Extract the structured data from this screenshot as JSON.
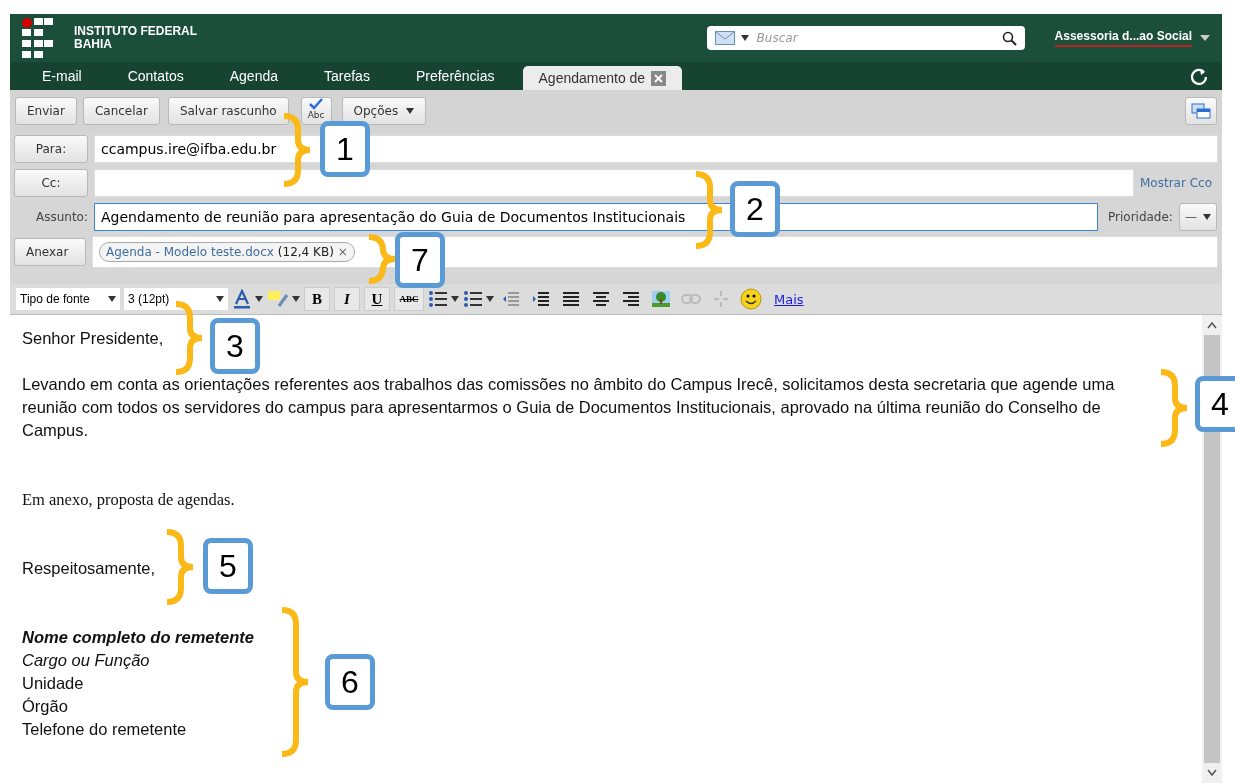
{
  "header": {
    "logo_lines": [
      "INSTITUTO FEDERAL",
      "BAHIA"
    ],
    "search": {
      "placeholder": "Buscar"
    },
    "user": "Assessoria d...ao Social"
  },
  "nav_tabs": [
    {
      "label": "E-mail",
      "selected": false
    },
    {
      "label": "Contatos",
      "selected": false
    },
    {
      "label": "Agenda",
      "selected": false
    },
    {
      "label": "Tarefas",
      "selected": false
    },
    {
      "label": "Preferências",
      "selected": false
    },
    {
      "label": "Agendamento de",
      "selected": true,
      "closable": true
    }
  ],
  "toolbar": {
    "buttons": [
      {
        "label": "Enviar",
        "kind": "plain"
      },
      {
        "label": "Cancelar",
        "kind": "plain"
      },
      {
        "label": "Salvar rascunho",
        "kind": "plain"
      },
      {
        "label": "Abc",
        "kind": "spell"
      },
      {
        "label": "Opções",
        "kind": "menu"
      }
    ]
  },
  "fields": {
    "to": {
      "label": "Para:",
      "value": "ccampus.ire@ifba.edu.br"
    },
    "cc": {
      "label": "Cc:",
      "link": "Mostrar Cco"
    },
    "subject": {
      "label": "Assunto:",
      "value": "Agendamento de reunião para apresentação do Guia de Documentos Institucionais",
      "focused": true
    },
    "priority": {
      "label": "Prioridade:",
      "value": "—"
    },
    "attach": {
      "label": "Anexar",
      "file": "Agenda - Modelo teste.docx",
      "size": "(12,4 KB)",
      "remove": "×"
    }
  },
  "editor_toolbar": {
    "font": "Tipo de fonte",
    "size": "3 (12pt)",
    "format": [
      "B",
      "I",
      "U",
      "ABC"
    ],
    "more": "Mais"
  },
  "body": [
    {
      "text": "Senhor Presidente,",
      "kind": "line"
    },
    {
      "text": "Levando em conta as orientações referentes aos trabalhos das comissões no âmbito do Campus Irecê, solicitamos desta secretaria que agende uma reunião com todos os servidores do campus para apresentarmos o Guia de Documentos Institucionais, aprovado na última reunião do Conselho de Campus.",
      "kind": "line"
    },
    {
      "text": "Em anexo, proposta de agendas.",
      "kind": "serif"
    },
    {
      "text": "Respeitosamente,",
      "kind": "line"
    },
    {
      "lines": [
        {
          "text": "Nome completo do remetente",
          "kind": "bolditalic"
        },
        {
          "text": "Cargo ou Função",
          "kind": "italic"
        },
        {
          "text": "Unidade",
          "kind": "plain"
        },
        {
          "text": "Órgão",
          "kind": "plain"
        },
        {
          "text": "Telefone do remetente",
          "kind": "plain"
        }
      ],
      "kind": "signature"
    }
  ],
  "annotations": [
    {
      "number": "1"
    },
    {
      "number": "2"
    },
    {
      "number": "3"
    },
    {
      "number": "4"
    },
    {
      "number": "5"
    },
    {
      "number": "6"
    },
    {
      "number": "7"
    }
  ]
}
